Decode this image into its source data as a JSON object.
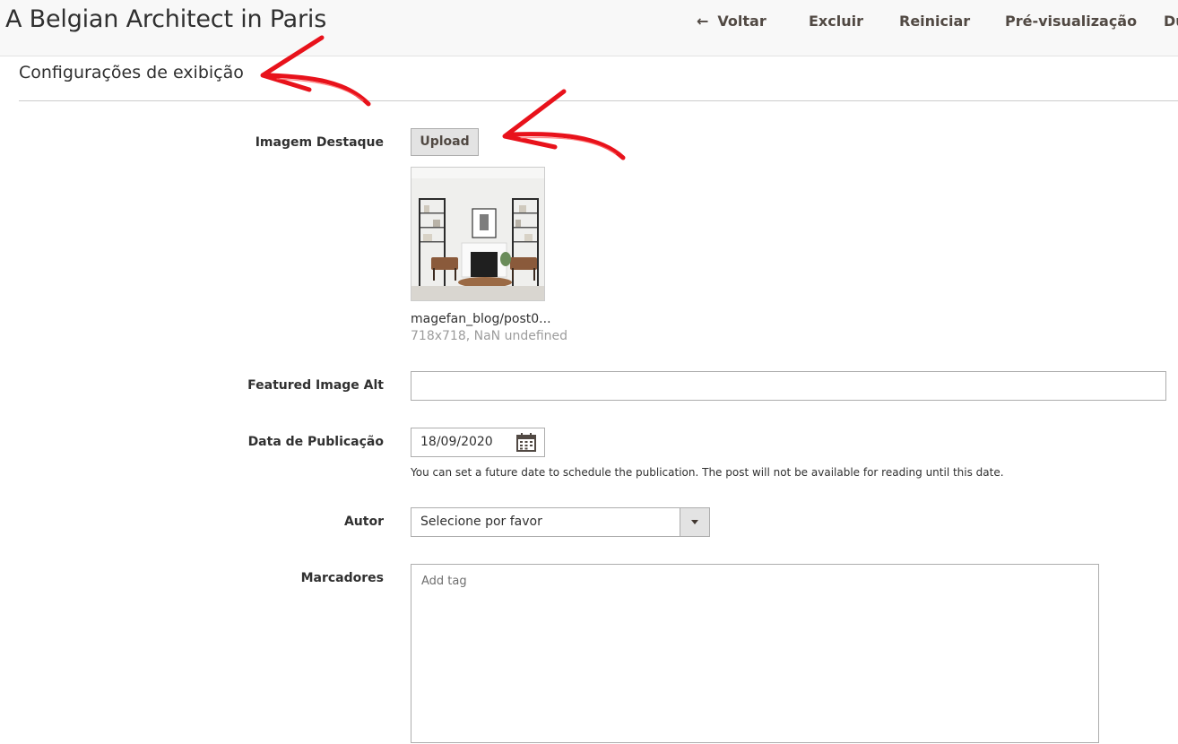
{
  "header": {
    "title": "A Belgian Architect in Paris",
    "actions": {
      "back": "Voltar",
      "delete": "Excluir",
      "reset": "Reiniciar",
      "preview": "Pré-visualização",
      "duplicate": "Du"
    }
  },
  "section": {
    "title": "Configurações de exibição"
  },
  "form": {
    "featured_image": {
      "label": "Imagem Destaque",
      "upload_label": "Upload",
      "file_name": "magefan_blog/post0...",
      "file_meta": "718x718, NaN undefined"
    },
    "featured_image_alt": {
      "label": "Featured Image Alt",
      "value": ""
    },
    "publish_date": {
      "label": "Data de Publicação",
      "value": "18/09/2020",
      "note": "You can set a future date to schedule the publication. The post will not be available for reading until this date."
    },
    "author": {
      "label": "Autor",
      "selected": "Selecione por favor"
    },
    "tags": {
      "label": "Marcadores",
      "placeholder": "Add tag"
    }
  },
  "icons": {
    "back": "arrow-left-icon",
    "calendar": "calendar-icon",
    "dropdown": "chevron-down-icon"
  },
  "colors": {
    "header_bg": "#f8f8f8",
    "action_text": "#514943",
    "annotation_arrow": "#e8121b"
  }
}
